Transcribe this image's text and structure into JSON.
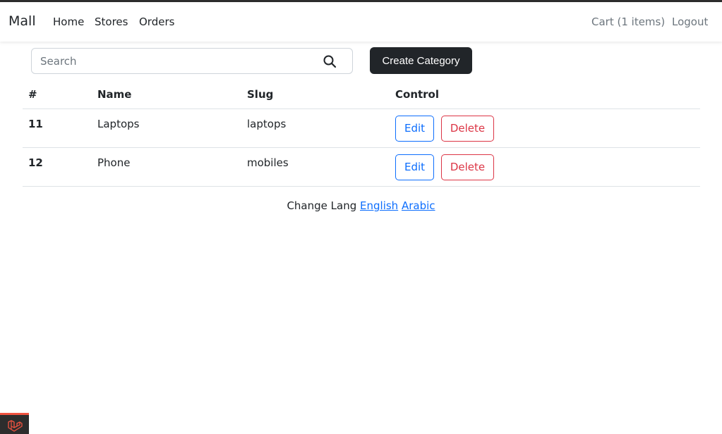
{
  "navbar": {
    "brand": "Mall",
    "links": [
      "Home",
      "Stores",
      "Orders"
    ],
    "cart": "Cart (1 items)",
    "logout": "Logout"
  },
  "search": {
    "placeholder": "Search",
    "value": ""
  },
  "create_button": "Create Category",
  "table": {
    "headers": [
      "#",
      "Name",
      "Slug",
      "Control"
    ],
    "rows": [
      {
        "id": "11",
        "name": "Laptops",
        "slug": "laptops",
        "edit": "Edit",
        "delete": "Delete"
      },
      {
        "id": "12",
        "name": "Phone",
        "slug": "mobiles",
        "edit": "Edit",
        "delete": "Delete"
      }
    ]
  },
  "lang": {
    "label": "Change Lang",
    "english": "English",
    "arabic": "Arabic"
  },
  "colors": {
    "primary": "#0d6efd",
    "danger": "#dc3545",
    "dark": "#212529",
    "laravel": "#f05340"
  },
  "icons": {
    "search": "search-icon",
    "debugbar": "laravel-logo-icon"
  }
}
